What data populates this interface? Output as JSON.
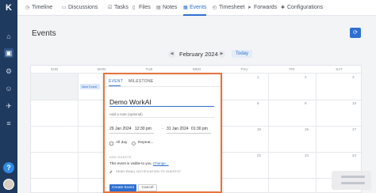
{
  "rail": {
    "logo": "K",
    "icons": [
      "home-icon",
      "inbox-icon",
      "settings-icon",
      "user-icon",
      "rocket-icon",
      "list-icon"
    ]
  },
  "tabs": [
    {
      "label": "Timeline",
      "icon": "timeline-icon",
      "glyph": "◷"
    },
    {
      "label": "Discussions",
      "icon": "discussions-icon",
      "glyph": "▭"
    },
    {
      "label": "Tasks",
      "icon": "tasks-icon",
      "glyph": "☑"
    },
    {
      "label": "Files",
      "icon": "files-icon",
      "glyph": "▯"
    },
    {
      "label": "Notes",
      "icon": "notes-icon",
      "glyph": "▤"
    },
    {
      "label": "Events",
      "icon": "events-icon",
      "glyph": "▦",
      "active": true
    },
    {
      "label": "Timesheet",
      "icon": "timesheet-icon",
      "glyph": "◴"
    },
    {
      "label": "Forwards",
      "icon": "forwards-icon",
      "glyph": "➤"
    },
    {
      "label": "Configurations",
      "icon": "configurations-icon",
      "glyph": "✱"
    }
  ],
  "page": {
    "title": "Events",
    "month": "February 2024",
    "today_label": "Today",
    "add_glyph": "⟳"
  },
  "calendar": {
    "weekdays": [
      "SUN",
      "MON",
      "TUE",
      "WED",
      "THU",
      "FRI",
      "SAT"
    ],
    "day_numbers": [
      "1",
      "2",
      "3",
      "8",
      "9",
      "10",
      "15",
      "16",
      "17",
      "22",
      "23",
      "24"
    ],
    "new_event_chip": "New Event"
  },
  "popup": {
    "tab_event": "EVENT",
    "tab_milestone": "MILESTONE",
    "event_name": "Demo WorkAI",
    "note_placeholder": "Add a note (optional)",
    "start_date": "29 Jan 2024",
    "start_time": "12:30 pm",
    "end_date": "31 Jan 2024",
    "end_time": "01:30 pm",
    "dash": "-",
    "all_day_label": "All day",
    "repeat_label": "Repeat...",
    "section_label": "ADD GUESTS",
    "visibility_text": "This event is visible to you.",
    "change_link": "Change...",
    "notify_label": "SEND EMAIL NOTIFICATION TO GUESTS?",
    "notify_check": "✔",
    "create_label": "Create Event",
    "cancel_label": "Cancel"
  },
  "colors": {
    "accent": "#2e6fd1",
    "popup_border": "#e8743b",
    "rail": "#1e3a5f"
  }
}
